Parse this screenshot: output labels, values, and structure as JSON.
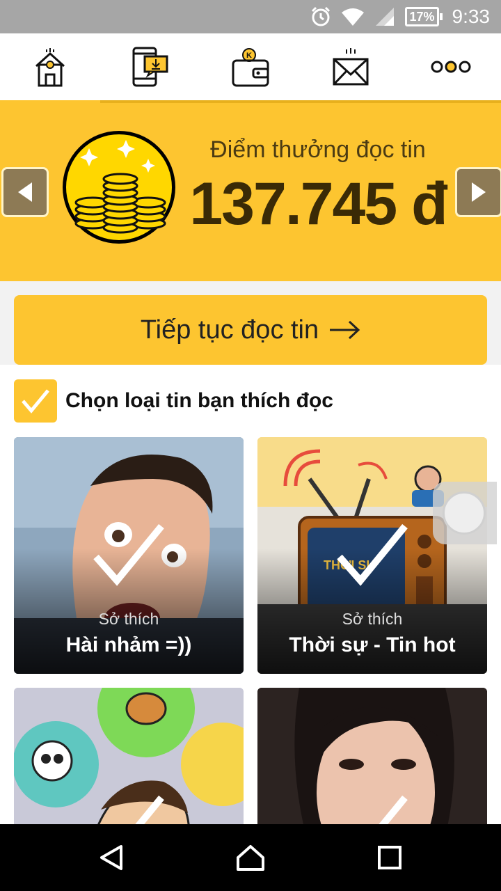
{
  "status_bar": {
    "battery": "17%",
    "time": "9:33",
    "icons": [
      "alarm-icon",
      "wifi-icon",
      "signal-icon",
      "battery-icon"
    ]
  },
  "nav": {
    "items": [
      {
        "name": "home",
        "icon": "home-icon"
      },
      {
        "name": "phone-download",
        "icon": "phone-download-icon"
      },
      {
        "name": "wallet",
        "icon": "wallet-icon"
      },
      {
        "name": "mail",
        "icon": "mail-icon"
      },
      {
        "name": "more",
        "icon": "more-dots-icon"
      }
    ]
  },
  "banner": {
    "label": "Điểm thưởng đọc tin",
    "value": "137.745 đ",
    "icon": "coins-icon"
  },
  "continue_button": {
    "label": "Tiếp tục đọc tin",
    "icon": "arrow-right-icon"
  },
  "categories": {
    "title": "Chọn loại tin bạn thích đọc",
    "items": [
      {
        "subtitle": "Sở thích",
        "title": "Hài nhảm =))",
        "checked": true
      },
      {
        "subtitle": "Sở thích",
        "title": "Thời sự - Tin hot",
        "checked": true
      },
      {
        "subtitle": "",
        "title": "",
        "checked": true
      },
      {
        "subtitle": "",
        "title": "",
        "checked": true
      }
    ]
  },
  "colors": {
    "accent": "#fdc530",
    "status_bar": "#a6a6a6",
    "system_nav": "#000000"
  }
}
